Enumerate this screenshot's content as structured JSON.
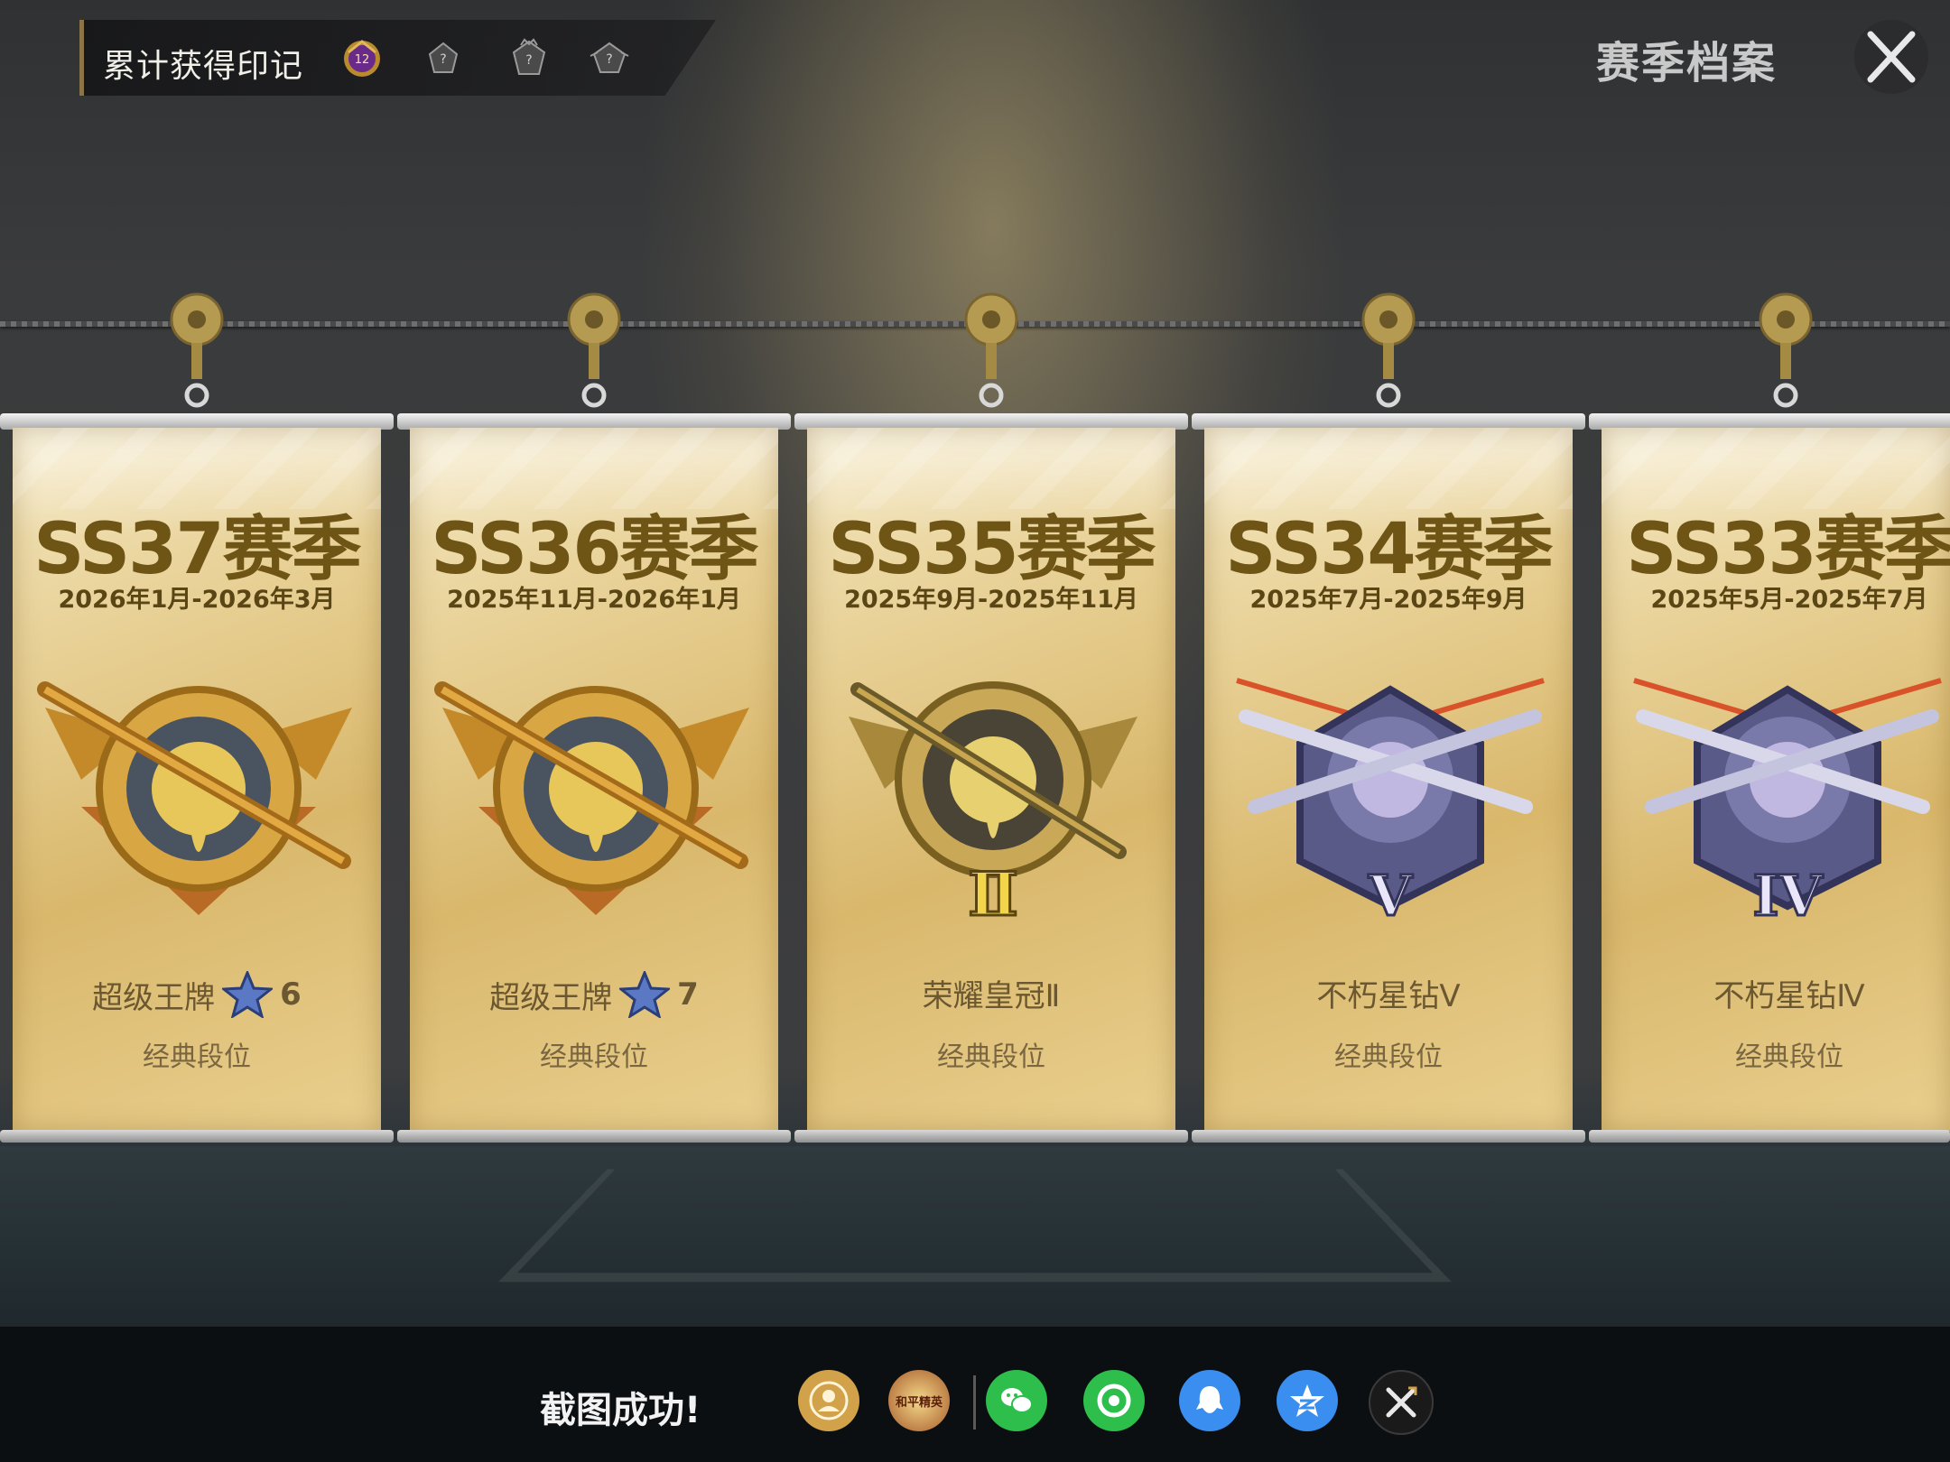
{
  "header": {
    "title": "累计获得印记",
    "marks": [
      {
        "icon": "mark-badge-12-icon",
        "value": "12"
      },
      {
        "icon": "mark-locked-icon",
        "value": "?"
      },
      {
        "icon": "mark-locked-icon",
        "value": "?"
      },
      {
        "icon": "mark-locked-icon",
        "value": "?"
      }
    ],
    "archive_title": "赛季档案",
    "close_icon": "close-icon"
  },
  "seasons": [
    {
      "title": "SS37赛季",
      "dates": "2026年1月-2026年3月",
      "rank": "超级王牌",
      "stars": "6",
      "type": "经典段位",
      "emblem": "gold-ace"
    },
    {
      "title": "SS36赛季",
      "dates": "2025年11月-2026年1月",
      "rank": "超级王牌",
      "stars": "7",
      "type": "经典段位",
      "emblem": "gold-ace"
    },
    {
      "title": "SS35赛季",
      "dates": "2025年9月-2025年11月",
      "rank": "荣耀皇冠Ⅱ",
      "tier": "Ⅱ",
      "type": "经典段位",
      "emblem": "crown"
    },
    {
      "title": "SS34赛季",
      "dates": "2025年7月-2025年9月",
      "rank": "不朽星钻Ⅴ",
      "tier": "V",
      "type": "经典段位",
      "emblem": "diamond"
    },
    {
      "title": "SS33赛季",
      "dates": "2025年5月-2025年7月",
      "rank": "不朽星钻Ⅳ",
      "tier": "IV",
      "type": "经典段位",
      "emblem": "diamond"
    }
  ],
  "share_bar": {
    "status": "截图成功!",
    "targets": [
      {
        "name": "profile",
        "icon": "profile-share-icon",
        "color": "#d1a24a"
      },
      {
        "name": "game-logo",
        "icon": "game-logo-icon",
        "color": "#a65a2a",
        "text": "和平精英"
      },
      {
        "name": "wechat",
        "icon": "wechat-icon",
        "color": "#2dbe4c"
      },
      {
        "name": "moments",
        "icon": "moments-icon",
        "color": "#2dbe4c"
      },
      {
        "name": "qq",
        "icon": "qq-icon",
        "color": "#3a8ef0"
      },
      {
        "name": "qzone",
        "icon": "qzone-icon",
        "color": "#3a8ef0"
      },
      {
        "name": "close-share",
        "icon": "close-share-icon",
        "color": "#1a1a1a"
      }
    ]
  }
}
